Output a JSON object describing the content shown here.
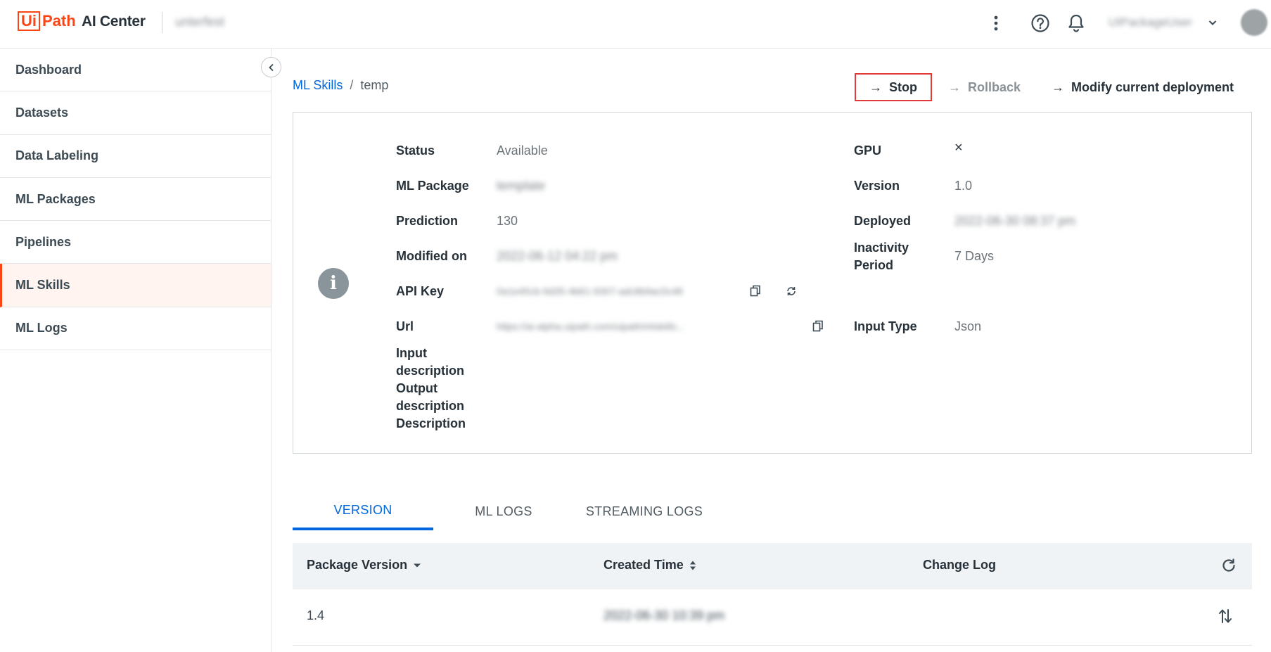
{
  "header": {
    "logo_ui": "Ui",
    "logo_path": "Path",
    "product": "AI Center",
    "tenant": "unterfest",
    "user": "UIPackageUser"
  },
  "sidebar": {
    "items": [
      {
        "label": "Dashboard"
      },
      {
        "label": "Datasets"
      },
      {
        "label": "Data Labeling"
      },
      {
        "label": "ML Packages"
      },
      {
        "label": "Pipelines"
      },
      {
        "label": "ML Skills",
        "active": true
      },
      {
        "label": "ML Logs"
      }
    ]
  },
  "breadcrumb": {
    "root": "ML Skills",
    "separator": "/",
    "current": "temp"
  },
  "actions": {
    "arrow": "→",
    "stop": "Stop",
    "rollback": "Rollback",
    "modify": "Modify current deployment"
  },
  "details": {
    "status_label": "Status",
    "status_value": "Available",
    "package_label": "ML Package",
    "package_value": "template",
    "prediction_label": "Prediction",
    "prediction_value": "130",
    "modified_label": "Modified on",
    "modified_value": "2022-06-12 04:22 pm",
    "apikey_label": "API Key",
    "apikey_value": "0a1e45cb-9d35-4b61-9307-adc8b9ac0c48",
    "url_label": "Url",
    "url_value": "https://ai-alpha.uipath.com/uipath/mlskills...",
    "input_desc_label": "Input description",
    "output_desc_label": "Output description",
    "description_label": "Description",
    "gpu_label": "GPU",
    "gpu_value": "×",
    "version_label": "Version",
    "version_value": "1.0",
    "deployed_label": "Deployed",
    "deployed_value": "2022-06-30 08:37 pm",
    "inactivity_label": "Inactivity Period",
    "inactivity_value": "7 Days",
    "input_type_label": "Input Type",
    "input_type_value": "Json"
  },
  "tabs": [
    {
      "label": "VERSION",
      "active": true
    },
    {
      "label": "ML LOGS"
    },
    {
      "label": "STREAMING LOGS"
    }
  ],
  "table": {
    "columns": [
      "Package Version",
      "Created Time",
      "Change Log"
    ],
    "rows": [
      {
        "version": "1.4",
        "created": "2022-06-30 10:39 pm",
        "changelog": ""
      }
    ]
  },
  "icons": {
    "more": "more-vertical-icon",
    "help": "help-circle-icon",
    "notifications": "bell-icon",
    "copy": "copy-icon",
    "regenerate": "refresh-icon",
    "info": "info-icon",
    "refresh_table": "refresh-icon",
    "swap": "swap-versions-icon"
  },
  "colors": {
    "brand": "#fa4616",
    "accent": "#0067df",
    "stop_border": "#e03a3a"
  }
}
